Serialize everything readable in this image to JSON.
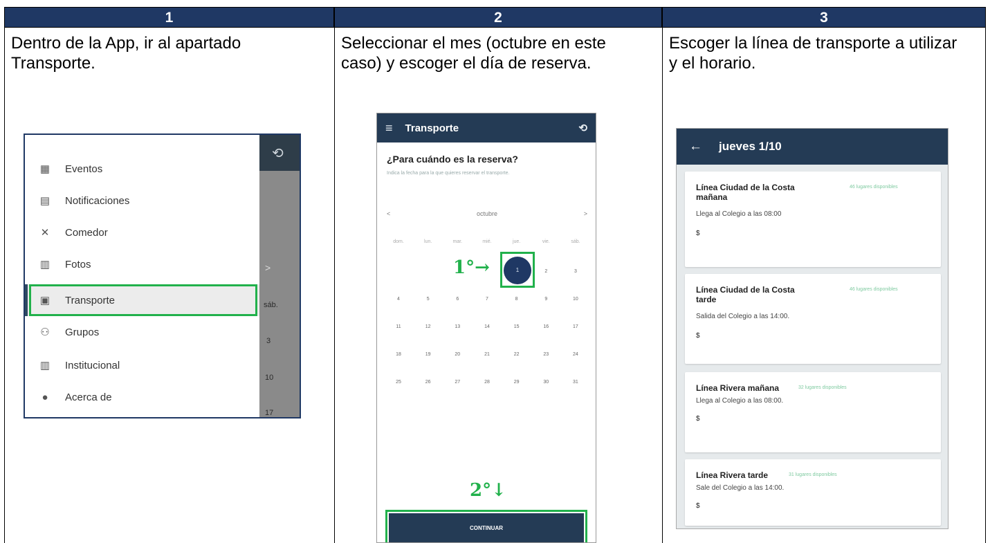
{
  "header": {
    "col1": "1",
    "col2": "2",
    "col3": "3"
  },
  "step1": {
    "text": "Dentro de la App, ir al apartado Transporte.",
    "menu": [
      {
        "label": "Eventos",
        "icon": "calendar-icon",
        "glyph": "▦"
      },
      {
        "label": "Notificaciones",
        "icon": "message-icon",
        "glyph": "▤"
      },
      {
        "label": "Comedor",
        "icon": "cutlery-icon",
        "glyph": "✕"
      },
      {
        "label": "Fotos",
        "icon": "photos-icon",
        "glyph": "▥"
      },
      {
        "label": "Transporte",
        "icon": "bus-icon",
        "glyph": "▣"
      },
      {
        "label": "Grupos",
        "icon": "group-icon",
        "glyph": "⚇"
      },
      {
        "label": "Institucional",
        "icon": "building-icon",
        "glyph": "▥"
      },
      {
        "label": "Acerca de",
        "icon": "info-icon",
        "glyph": "●"
      }
    ],
    "overlay": {
      "arrow": ">",
      "t1": "sáb.",
      "t2": "3",
      "t3": "10",
      "t4": "17"
    }
  },
  "step2": {
    "text": "Seleccionar el mes (octubre en este caso) y escoger el día de reserva.",
    "bar_title": "Transporte",
    "question": "¿Para cuándo es la reserva?",
    "subtext": "Indica la fecha para la que quieres reservar el transporte.",
    "month": "octubre",
    "prev": "<",
    "next": ">",
    "daynames": [
      "dom.",
      "lun.",
      "mar.",
      "mié.",
      "jue.",
      "vie.",
      "sáb."
    ],
    "weeks": [
      [
        "",
        "",
        "",
        "",
        "1",
        "2",
        "3"
      ],
      [
        "4",
        "5",
        "6",
        "7",
        "8",
        "9",
        "10"
      ],
      [
        "11",
        "12",
        "13",
        "14",
        "15",
        "16",
        "17"
      ],
      [
        "18",
        "19",
        "20",
        "21",
        "22",
        "23",
        "24"
      ],
      [
        "25",
        "26",
        "27",
        "28",
        "29",
        "30",
        "31"
      ]
    ],
    "selected_day": "1",
    "step_a": "1°→",
    "step_b": "2°↓",
    "button": "CONTINUAR"
  },
  "step3": {
    "text": "Escoger la línea de transporte a utilizar y el horario.",
    "bar_title": "jueves 1/10",
    "cards": [
      {
        "title": "Línea Ciudad de la Costa mañana",
        "avail": "46 lugares disponibles",
        "detail": "Llega al Colegio a las 08:00",
        "price": "$"
      },
      {
        "title": "Línea Ciudad de la Costa tarde",
        "avail": "46 lugares disponibles",
        "detail": "Salida del Colegio a las 14:00.",
        "price": "$"
      },
      {
        "title": "Línea Rivera mañana",
        "avail": "32 lugares disponibles",
        "detail": "Llega al Colegio a las 08:00.",
        "price": "$"
      },
      {
        "title": "Línea Rivera tarde",
        "avail": "31 lugares disponibles",
        "detail": "Sale del Colegio a las 14:00.",
        "price": "$"
      }
    ]
  },
  "colors": {
    "header": "#1f3864",
    "highlight": "#21b14b",
    "appbar": "#243b55"
  }
}
